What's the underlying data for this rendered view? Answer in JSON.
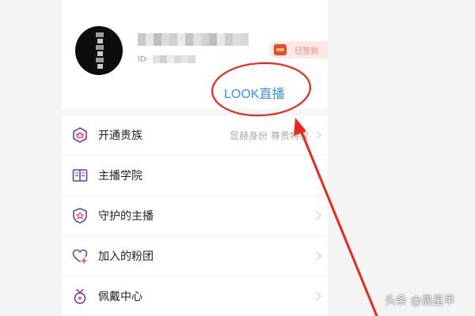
{
  "profile": {
    "uid_label": "ID·",
    "checkin_label": "已签到"
  },
  "annotation": {
    "highlight_text": "LOOK直播",
    "color": "#e8291c"
  },
  "menu": {
    "items": [
      {
        "label": "开通贵族",
        "sub": "显赫身份 尊贵特权",
        "icon": "noble-crown-icon"
      },
      {
        "label": "主播学院",
        "sub": "",
        "icon": "book-icon"
      },
      {
        "label": "守护的主播",
        "sub": "",
        "icon": "shield-star-icon"
      },
      {
        "label": "加入的粉团",
        "sub": "",
        "icon": "heart-plus-icon"
      },
      {
        "label": "佩戴中心",
        "sub": "",
        "icon": "medal-icon"
      }
    ]
  },
  "watermark": "头条 @晨星早",
  "colors": {
    "icon": "#6a3ea1",
    "accent_blue": "#3a91e6",
    "annotation_red": "#e8291c"
  }
}
